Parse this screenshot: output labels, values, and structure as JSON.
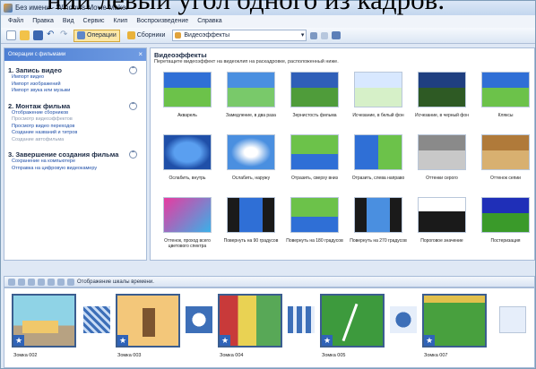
{
  "document_overlay": {
    "text": "ний левый угол одного из кадров."
  },
  "window": {
    "title": "Без имени - Windows Movie Maker"
  },
  "menu": [
    "Файл",
    "Правка",
    "Вид",
    "Сервис",
    "Клип",
    "Воспроизведение",
    "Справка"
  ],
  "toolbar": {
    "operations_label": "Операции",
    "collections_label": "Сборники",
    "collection_combo_value": "Видеоэффекты"
  },
  "taskpane": {
    "header": "Операции с фильмами",
    "sections": [
      {
        "title": "1. Запись видео",
        "links": [
          "Импорт видео",
          "Импорт изображений",
          "Импорт звука или музыки"
        ]
      },
      {
        "title": "2. Монтаж фильма",
        "links": [
          "Отображение сборников",
          "Просмотр видеоэффектов",
          "Просмотр видео переходов",
          "Создание названий и титров",
          "Создание автофильма"
        ]
      },
      {
        "title": "3. Завершение создания фильма",
        "links": [
          "Сохранение на компьютере",
          "Отправка на цифровую видеокамеру"
        ]
      }
    ]
  },
  "content": {
    "title": "Видеоэффекты",
    "subtitle": "Перетащите видеоэффект на видеоклип на раскадровке, расположенный ниже.",
    "effects": [
      "Акварель",
      "Замедление, в два раза",
      "Зернистость фильма",
      "Исчезание, в белый фон",
      "Исчезание, в черный фон",
      "Кляксы",
      "Ослабить, внутрь",
      "Ослабить, наружу",
      "Отразить, сверху вниз",
      "Отразить, слева направо",
      "Оттенки серого",
      "Оттенок сепии",
      "Оттенок, проход всего цветового спектра",
      "Повернуть на 90 градусов",
      "Повернуть на 180 градусов",
      "Повернуть на 270 градусов",
      "Пороговое значение",
      "Постеризация"
    ]
  },
  "storyboard": {
    "toolbar_label": "Отображение шкалы времени.",
    "clips": [
      "Зомка 002",
      "Зомка 003",
      "Зомка 004",
      "Зомка 005",
      "Зомка 007"
    ]
  }
}
